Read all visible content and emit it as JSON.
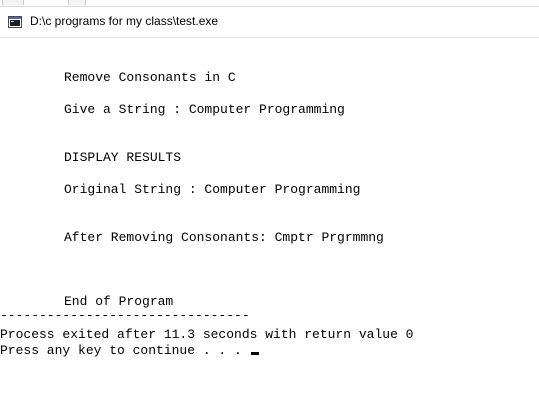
{
  "window": {
    "title": "D:\\c programs for my class\\test.exe",
    "icon": "console-app-icon"
  },
  "console": {
    "heading": "Remove Consonants in C",
    "prompt": "Give a String : Computer Programming",
    "results_header": "DISPLAY RESULTS",
    "original": "Original String : Computer Programming",
    "after": "After Removing Consonants: Cmptr Prgrmmng",
    "end": "End of Program",
    "separator": "--------------------------------",
    "process_exit": "Process exited after 11.3 seconds with return value 0",
    "press_key": "Press any key to continue . . . "
  }
}
